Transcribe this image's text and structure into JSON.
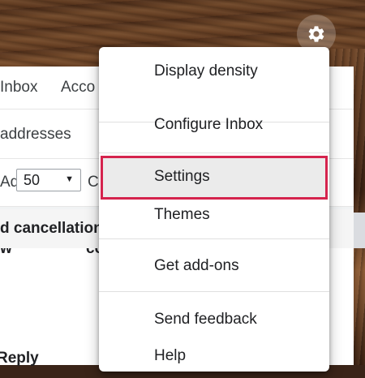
{
  "page": {
    "tabs_row": [
      "Inbox",
      "Acco"
    ],
    "addresses_row": "addresses",
    "advanced_row": [
      "Advanced",
      "C"
    ],
    "show_prefix": "w",
    "page_size": "50",
    "show_suffix": "co",
    "cancellation_text": "d cancellation",
    "reply_text": "Reply"
  },
  "menu": {
    "items": [
      {
        "label": "Display density"
      },
      {
        "label": "Configure Inbox"
      },
      {
        "label": "Settings",
        "highlighted": true
      },
      {
        "label": "Themes"
      },
      {
        "label": "Get add-ons"
      },
      {
        "label": "Send feedback"
      },
      {
        "label": "Help"
      }
    ]
  },
  "icons": {
    "settings": "gear-icon",
    "dropdown": "triangle-down-icon"
  },
  "colors": {
    "highlight_border": "#d5234d",
    "highlight_fill": "#ebebeb"
  }
}
